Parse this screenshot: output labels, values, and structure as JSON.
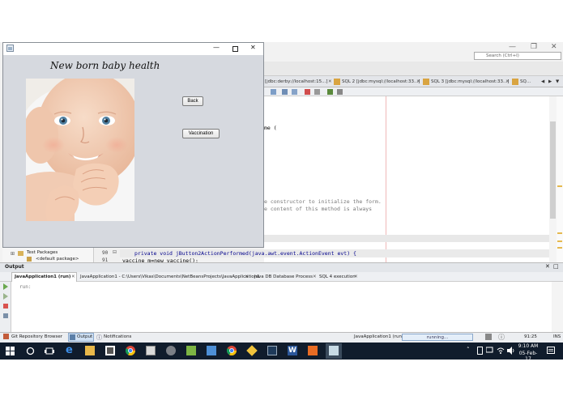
{
  "ide": {
    "search_placeholder": "Search (Ctrl+I)",
    "editor_tabs": [
      "[jdbc:derby://localhost:15...]",
      "SQL 2 [jdbc:mysql://localhost:33...]",
      "SQL 3 [jdbc:mysql://localhost:33...]",
      "SQ..."
    ],
    "code_lines": [
      "me (",
      "e constructor to initialize the form.",
      "e content of this method is always"
    ],
    "line_numbers": [
      "90",
      "91"
    ],
    "code_method": "private void jButton2ActionPerformed(java.awt.event.ActionEvent evt) {",
    "code_vaccine": "vaccine m=new vaccine();",
    "project_items": [
      "Test Packages",
      "<default package>"
    ]
  },
  "output": {
    "title": "Output",
    "tabs": [
      "JavaApplication1 (run)",
      "JavaApplication1 - C:\\Users\\Vikas\\Documents\\NetBeansProjects\\JavaApplication1",
      "Java DB Database Process",
      "SQL 4 execution"
    ],
    "console_text": "run:"
  },
  "status_bar": {
    "git": "Git Repository Browser",
    "output": "Output",
    "notifications": "Notifications",
    "app": "JavaApplication1 (run)",
    "progress": "running...",
    "position": "91:25",
    "mode": "INS"
  },
  "taskbar": {
    "time": "9:10 AM",
    "date": "05-Feb-17"
  },
  "app_window": {
    "heading": "New born baby health",
    "back_label": "Back",
    "vaccination_label": "Vaccination"
  }
}
